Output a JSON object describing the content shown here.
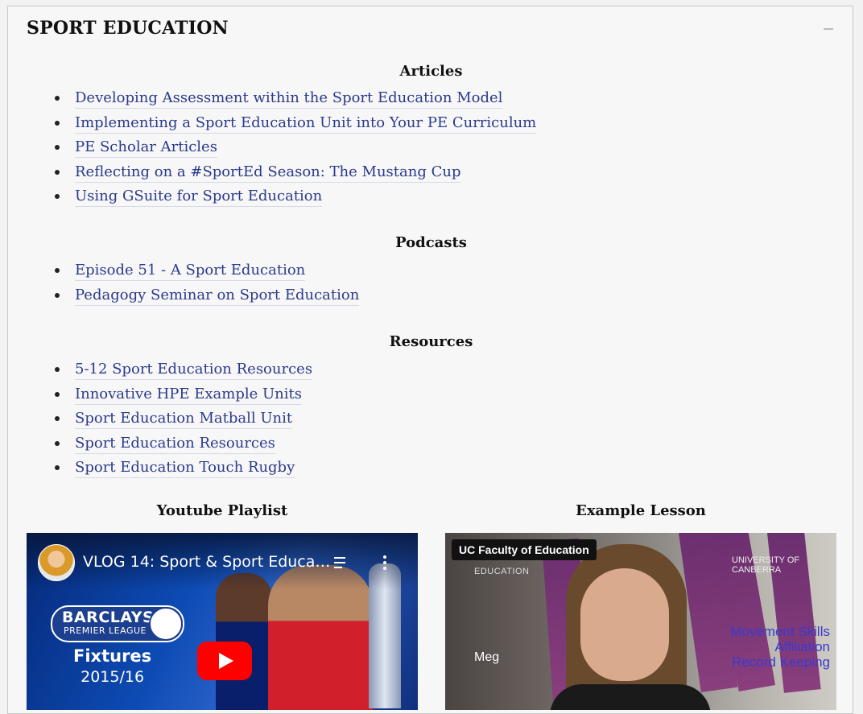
{
  "panel": {
    "title": "SPORT EDUCATION",
    "collapse_icon": "minus-icon"
  },
  "sections": [
    {
      "heading": "Articles",
      "links": [
        "Developing Assessment within the Sport Education Model",
        "Implementing a Sport Education Unit into Your PE Curriculum",
        "PE Scholar Articles",
        "Reflecting on a #SportEd Season: The Mustang Cup",
        "Using GSuite for Sport Education"
      ]
    },
    {
      "heading": "Podcasts",
      "links": [
        "Episode 51 - A Sport Education",
        "Pedagogy Seminar on Sport Education"
      ]
    },
    {
      "heading": "Resources",
      "links": [
        "5-12 Sport Education Resources",
        "Innovative HPE Example Units",
        "Sport Education Matball Unit",
        "Sport Education Resources",
        "Sport Education Touch Rugby"
      ]
    }
  ],
  "videos": [
    {
      "heading": "Youtube Playlist",
      "title": "VLOG 14: Sport & Sport Educati...",
      "thumb": {
        "brand_line1": "BARCLAYS",
        "brand_line2": "PREMIER LEAGUE",
        "fixtures": "Fixtures",
        "season": "2015/16"
      },
      "icons": [
        "playlist-icon",
        "more-vert-icon",
        "play-icon"
      ]
    },
    {
      "heading": "Example Lesson",
      "channel": "UC Faculty of Education",
      "thumb": {
        "edu_label": "EDUCATION",
        "logo_line1": "UNIVERSITY OF",
        "logo_line2": "CANBERRA",
        "name": "Meg",
        "overlay_lines": [
          "Movement Skills",
          "Affiliation",
          "Record Keeping"
        ]
      }
    }
  ],
  "colors": {
    "link": "#2b3a8c",
    "panel_bg": "#f7f7f7",
    "play_red": "#ff0000"
  }
}
